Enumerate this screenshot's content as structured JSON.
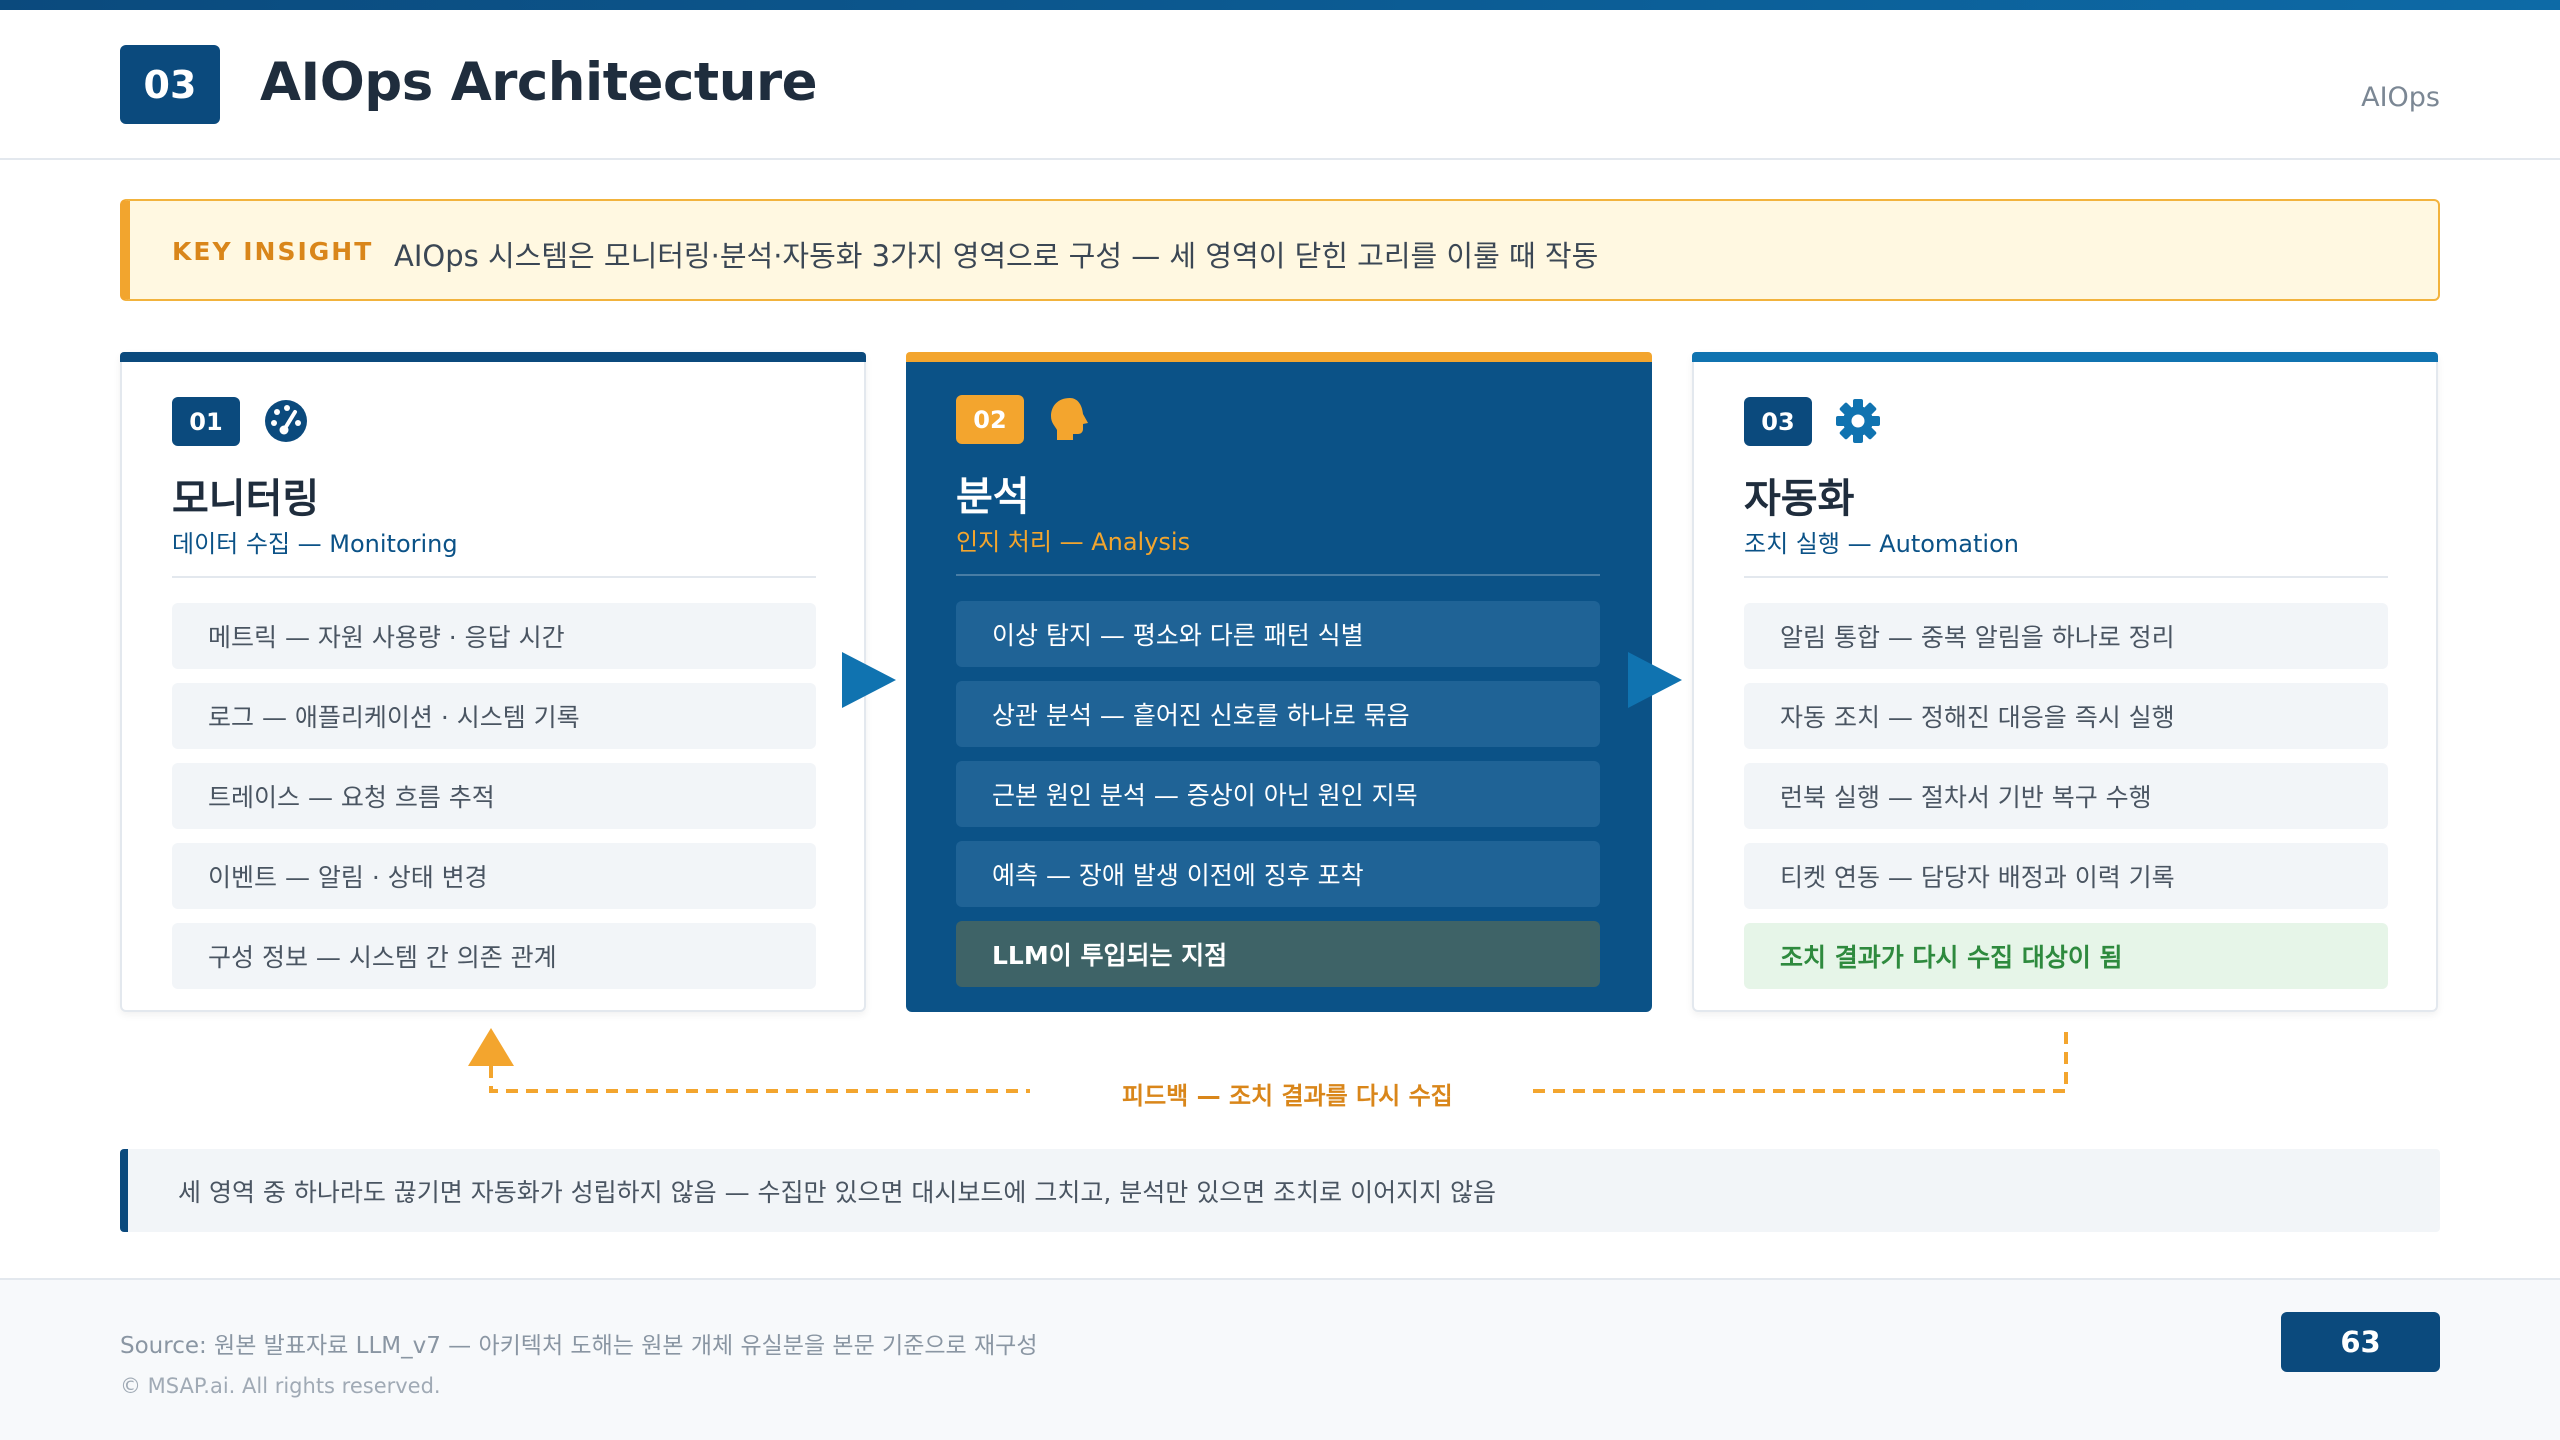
{
  "header": {
    "section_number": "03",
    "title": "AIOps Architecture",
    "tag": "AIOps"
  },
  "insight": {
    "label": "KEY INSIGHT",
    "text": "AIOps 시스템은 모니터링·분석·자동화 3가지 영역으로 구성 — 세 영역이 닫힌 고리를 이룰 때 작동"
  },
  "panels": [
    {
      "number": "01",
      "icon": "gauge-icon",
      "title": "모니터링",
      "subtitle": "데이터 수집 — Monitoring",
      "accent": "#0b4a7d",
      "items": [
        "메트릭 — 자원 사용량 · 응답 시간",
        "로그 — 애플리케이션 · 시스템 기록",
        "트레이스 — 요청 흐름 추적",
        "이벤트 — 알림 · 상태 변경",
        "구성 정보 — 시스템 간 의존 관계"
      ]
    },
    {
      "number": "02",
      "icon": "head-icon",
      "title": "분석",
      "subtitle": "인지 처리 — Analysis",
      "accent": "#f3a52e",
      "items": [
        "이상 탐지 — 평소와 다른 패턴 식별",
        "상관 분석 — 흩어진 신호를 하나로 묶음",
        "근본 원인 분석 — 증상이 아닌 원인 지목",
        "예측 — 장애 발생 이전에 징후 포착",
        "LLM이 투입되는 지점"
      ]
    },
    {
      "number": "03",
      "icon": "gear-icon",
      "title": "자동화",
      "subtitle": "조치 실행 — Automation",
      "accent": "#1073b0",
      "items": [
        "알림 통합 — 중복 알림을 하나로 정리",
        "자동 조치 — 정해진 대응을 즉시 실행",
        "런북 실행 — 절차서 기반 복구 수행",
        "티켓 연동 — 담당자 배정과 이력 기록",
        "조치 결과가 다시 수집 대상이 됨"
      ]
    }
  ],
  "feedback": {
    "label": "피드백 — 조치 결과를 다시 수집",
    "color": "#f3a52e"
  },
  "note": {
    "text": "세 영역 중 하나라도 끊기면 자동화가 성립하지 않음 — 수집만 있으면 대시보드에 그치고, 분석만 있으면 조치로 이어지지 않음"
  },
  "footer": {
    "source": "Source: 원본 발표자료 LLM_v7 — 아키텍처 도해는 원본 개체 유실분을 본문 기준으로 재구성",
    "copyright": "© MSAP.ai. All rights reserved.",
    "page": "63"
  }
}
